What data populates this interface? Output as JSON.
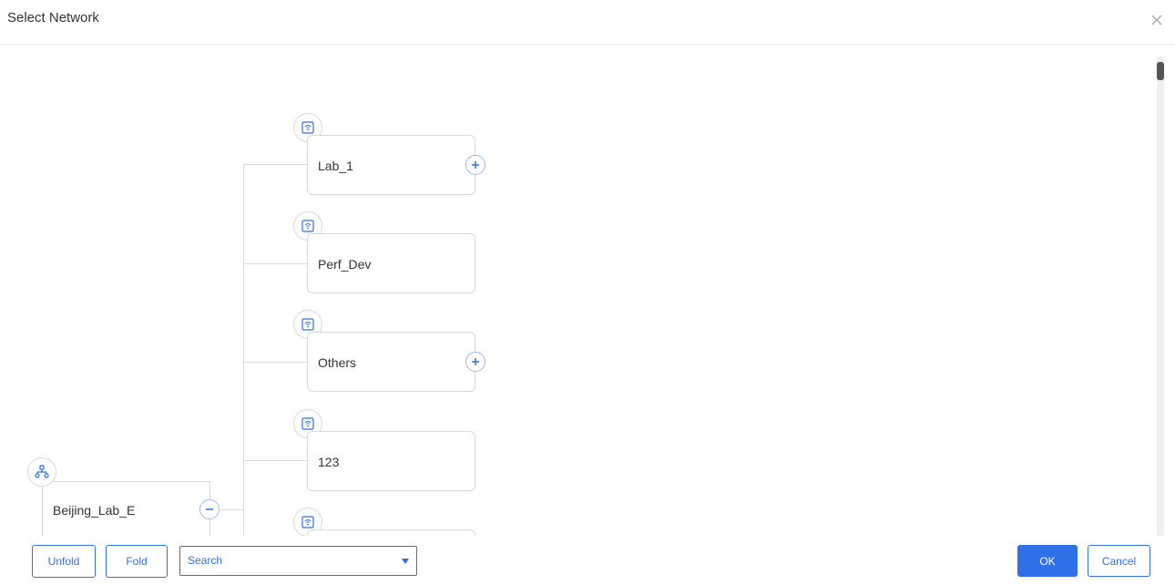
{
  "dialog": {
    "title": "Select Network"
  },
  "tree": {
    "root": {
      "label": "Beijing_Lab_E",
      "icon": "network-icon",
      "toggle": "minus"
    },
    "children": [
      {
        "label": "Lab_1",
        "icon": "wireless-icon",
        "toggle": "plus"
      },
      {
        "label": "Perf_Dev",
        "icon": "wireless-icon",
        "toggle": ""
      },
      {
        "label": "Others",
        "icon": "wireless-icon",
        "toggle": "plus"
      },
      {
        "label": "123",
        "icon": "wireless-icon",
        "toggle": ""
      }
    ]
  },
  "footer": {
    "unfold_label": "Unfold",
    "fold_label": "Fold",
    "search_label": "Search",
    "ok_label": "OK",
    "cancel_label": "Cancel"
  },
  "colors": {
    "accent": "#2f6fe8",
    "line": "#d9d9d9"
  }
}
